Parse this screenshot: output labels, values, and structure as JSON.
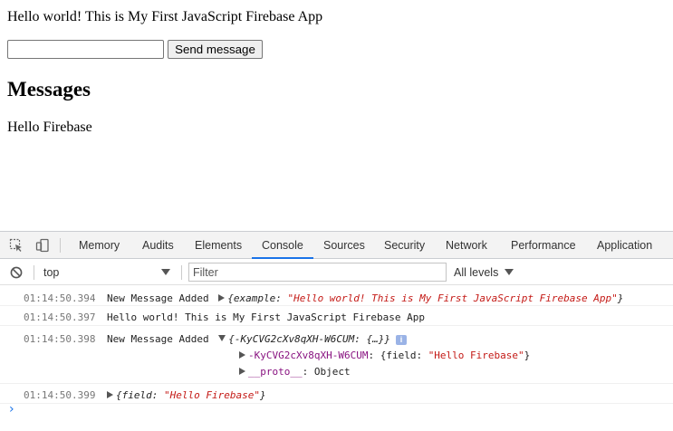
{
  "page": {
    "greeting": "Hello world! This is My First JavaScript Firebase App",
    "message_input": {
      "value": "",
      "placeholder": ""
    },
    "send_button": "Send message",
    "messages_heading": "Messages",
    "messages": [
      "Hello Firebase"
    ]
  },
  "devtools": {
    "tabs": [
      "Memory",
      "Audits",
      "Elements",
      "Console",
      "Sources",
      "Security",
      "Network",
      "Performance",
      "Application"
    ],
    "active_tab": "Console",
    "context": "top",
    "filter_placeholder": "Filter",
    "levels": "All levels",
    "log": [
      {
        "timestamp": "01:14:50.394",
        "prefix": "New Message Added",
        "object_open": "{example: ",
        "object_value": "\"Hello world! This is My First JavaScript Firebase App\"",
        "object_close": "}"
      },
      {
        "timestamp": "01:14:50.397",
        "text": "Hello world! This is My First JavaScript Firebase App"
      },
      {
        "timestamp": "01:14:50.398",
        "prefix": "New Message Added",
        "summary": "{-KyCVG2cXv8qXH-W6CUM: {…}}",
        "info_badge": "i",
        "children": [
          {
            "key": "-KyCVG2cXv8qXH-W6CUM",
            "sep": ": ",
            "open": "{field: ",
            "value": "\"Hello Firebase\"",
            "close": "}"
          },
          {
            "key": "__proto__",
            "sep": ": ",
            "value": "Object"
          }
        ]
      },
      {
        "timestamp": "01:14:50.399",
        "object_open": "{field: ",
        "object_value": "\"Hello Firebase\"",
        "object_close": "}"
      }
    ],
    "prompt": "›"
  },
  "colors": {
    "accent": "#1a73e8",
    "string": "#c41a16",
    "key": "#881280",
    "timestamp": "#777777"
  }
}
